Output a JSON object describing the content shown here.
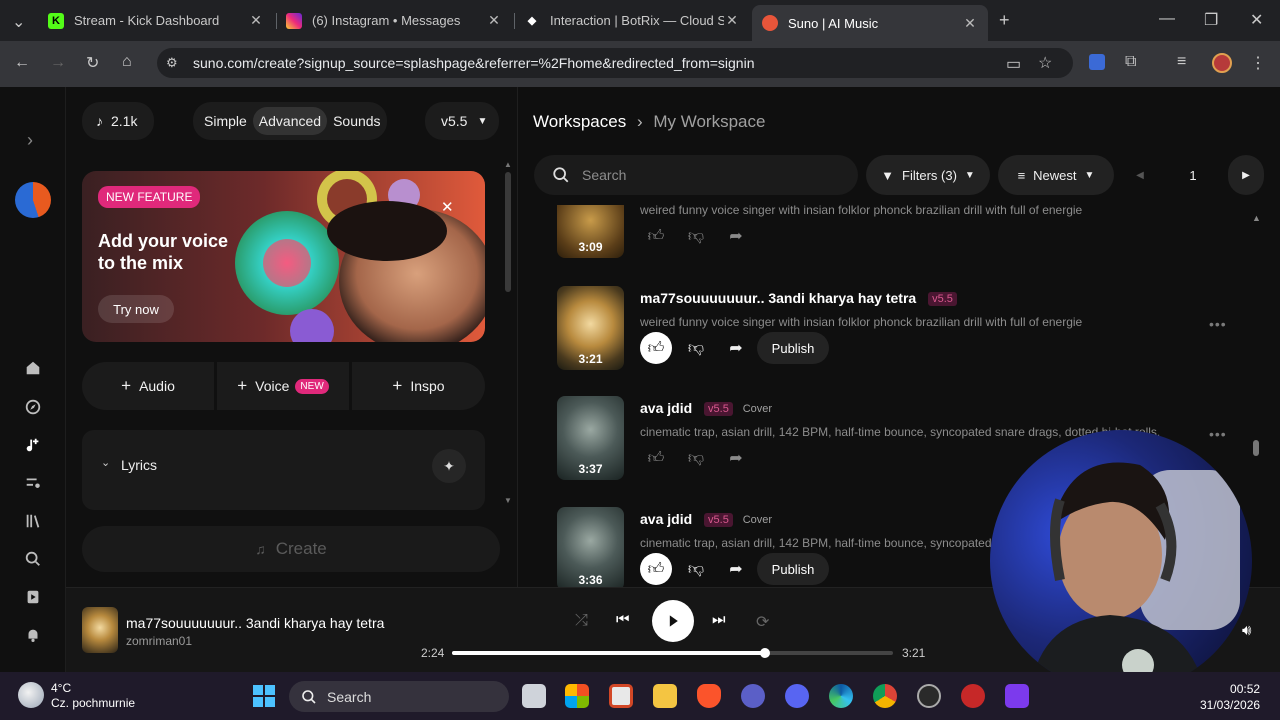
{
  "browser": {
    "tabs": [
      {
        "title": "Stream - Kick Dashboard",
        "icon": "kick-icon"
      },
      {
        "title": "(6) Instagram • Messages",
        "icon": "instagram-icon"
      },
      {
        "title": "Interaction | BotRix — Cloud Str",
        "icon": "botrix-icon"
      },
      {
        "title": "Suno | AI Music",
        "icon": "suno-icon"
      }
    ],
    "url": "suno.com/create?signup_source=splashpage&referrer=%2Fhome&redirected_from=signin"
  },
  "left": {
    "credits": "2.1k",
    "modes": [
      "Simple",
      "Advanced",
      "Sounds"
    ],
    "active_mode": "Advanced",
    "model": "v5.5",
    "banner": {
      "badge": "NEW FEATURE",
      "title": "Add your voice to the mix",
      "cta": "Try now"
    },
    "add_buttons": {
      "audio": "Audio",
      "voice": "Voice",
      "voice_badge": "NEW",
      "inspo": "Inspo"
    },
    "lyrics_label": "Lyrics",
    "create_label": "Create"
  },
  "right": {
    "breadcrumb_root": "Workspaces",
    "breadcrumb_current": "My Workspace",
    "search_placeholder": "Search",
    "filters_label": "Filters (3)",
    "sort_label": "Newest",
    "page": "1",
    "publish_label": "Publish",
    "songs": [
      {
        "title": "",
        "version": "",
        "tag": "",
        "desc": "weired funny voice singer with insian folklor phonck brazilian drill with full of energie",
        "duration": "3:09",
        "liked": false,
        "publish": false
      },
      {
        "title": "ma77souuuuuuur.. 3andi kharya hay tetra",
        "version": "v5.5",
        "tag": "",
        "desc": "weired funny voice singer with insian folklor phonck brazilian drill with full of energie",
        "duration": "3:21",
        "liked": true,
        "publish": true
      },
      {
        "title": "ava jdid",
        "version": "v5.5",
        "tag": "Cover",
        "desc": "cinematic trap, asian drill, 142 BPM, half-time bounce, syncopated snare drags, dotted hi-hat rolls, 808",
        "duration": "3:37",
        "liked": false,
        "publish": false
      },
      {
        "title": "ava jdid",
        "version": "v5.5",
        "tag": "Cover",
        "desc": "cinematic trap, asian drill, 142 BPM, half-time bounce, syncopated snare drags",
        "duration": "3:36",
        "liked": true,
        "publish": true
      }
    ]
  },
  "player": {
    "title": "ma77souuuuuuur.. 3andi kharya hay tetra",
    "artist": "zomriman01",
    "current": "2:24",
    "duration": "3:21",
    "progress": 0.71
  },
  "taskbar": {
    "temp": "4°C",
    "weather": "Cz. pochmurnie",
    "search": "Search",
    "time": "00:52",
    "date": "31/03/2026"
  },
  "colors": {
    "accent": "#e0297b",
    "background": "#101010"
  }
}
